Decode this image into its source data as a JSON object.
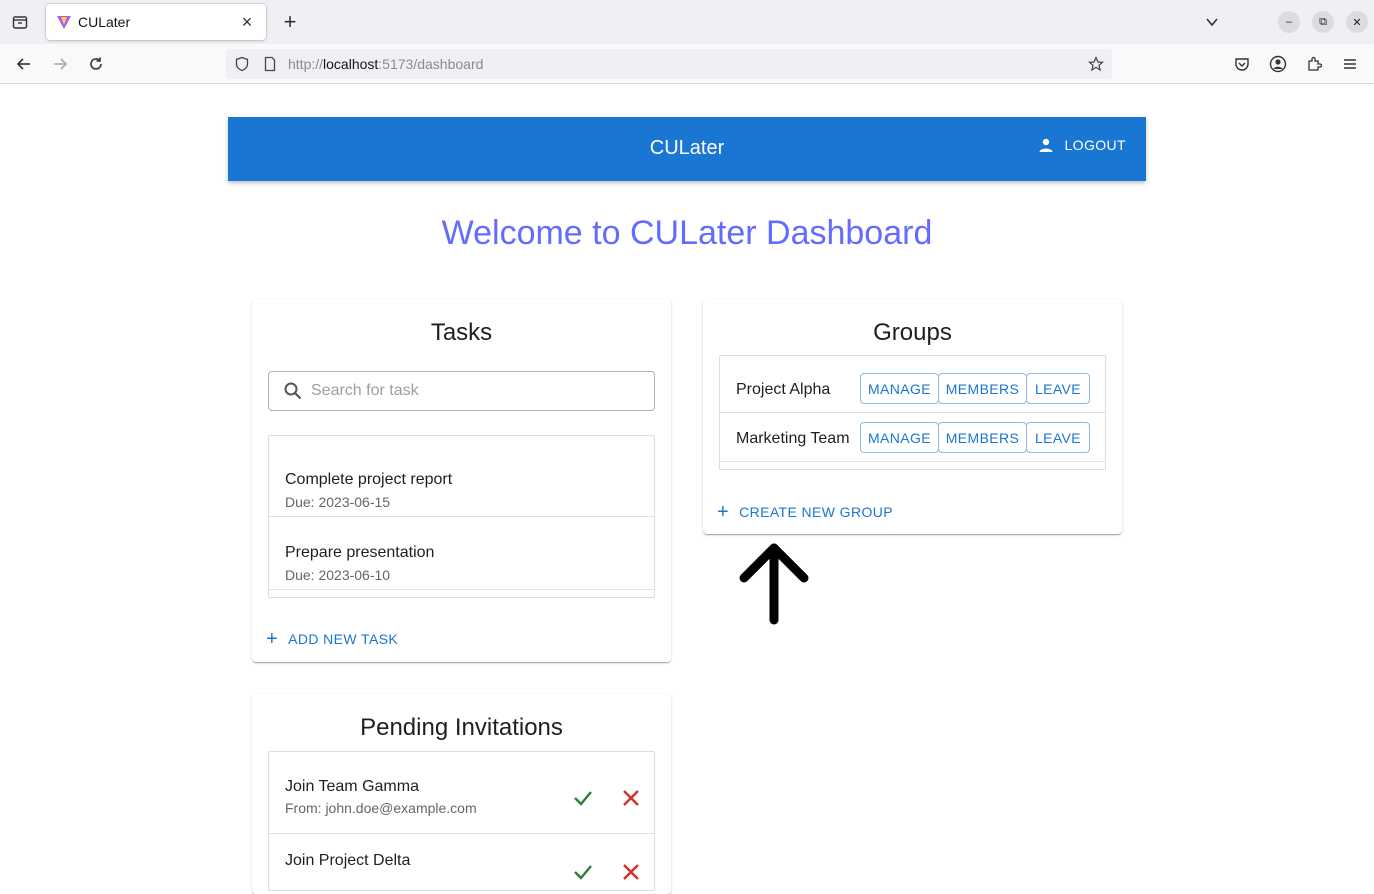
{
  "browser": {
    "tab_title": "CULater",
    "url_prefix": "http://",
    "url_host": "localhost",
    "url_rest": ":5173/dashboard",
    "icons": [
      "tab-list-icon",
      "close-icon",
      "plus-icon",
      "chevron-down-icon",
      "minimize-icon",
      "restore-icon",
      "window-close-icon",
      "back-icon",
      "forward-icon",
      "reload-icon",
      "shield-icon",
      "page-icon",
      "star-icon",
      "pocket-icon",
      "account-icon",
      "extensions-icon",
      "menu-icon"
    ]
  },
  "appbar": {
    "title": "CULater",
    "logout_label": "LOGOUT",
    "color": "#1976d2"
  },
  "welcome": "Welcome to CULater Dashboard",
  "tasks": {
    "title": "Tasks",
    "search_placeholder": "Search for task",
    "items": [
      {
        "name": "Complete project report",
        "due": "Due: 2023-06-15"
      },
      {
        "name": "Prepare presentation",
        "due": "Due: 2023-06-10"
      }
    ],
    "add_label": "ADD NEW TASK"
  },
  "groups": {
    "title": "Groups",
    "items": [
      {
        "name": "Project Alpha"
      },
      {
        "name": "Marketing Team"
      }
    ],
    "manage_label": "MANAGE",
    "members_label": "MEMBERS",
    "leave_label": "LEAVE",
    "create_label": "CREATE NEW GROUP"
  },
  "invitations": {
    "title": "Pending Invitations",
    "items": [
      {
        "name": "Join Team Gamma",
        "from": "From: john.doe@example.com"
      },
      {
        "name": "Join Project Delta",
        "from": ""
      }
    ]
  },
  "colors": {
    "accent": "#1976d2",
    "welcome": "#646cff",
    "accept": "#2e7d32",
    "decline": "#d32f2f"
  }
}
